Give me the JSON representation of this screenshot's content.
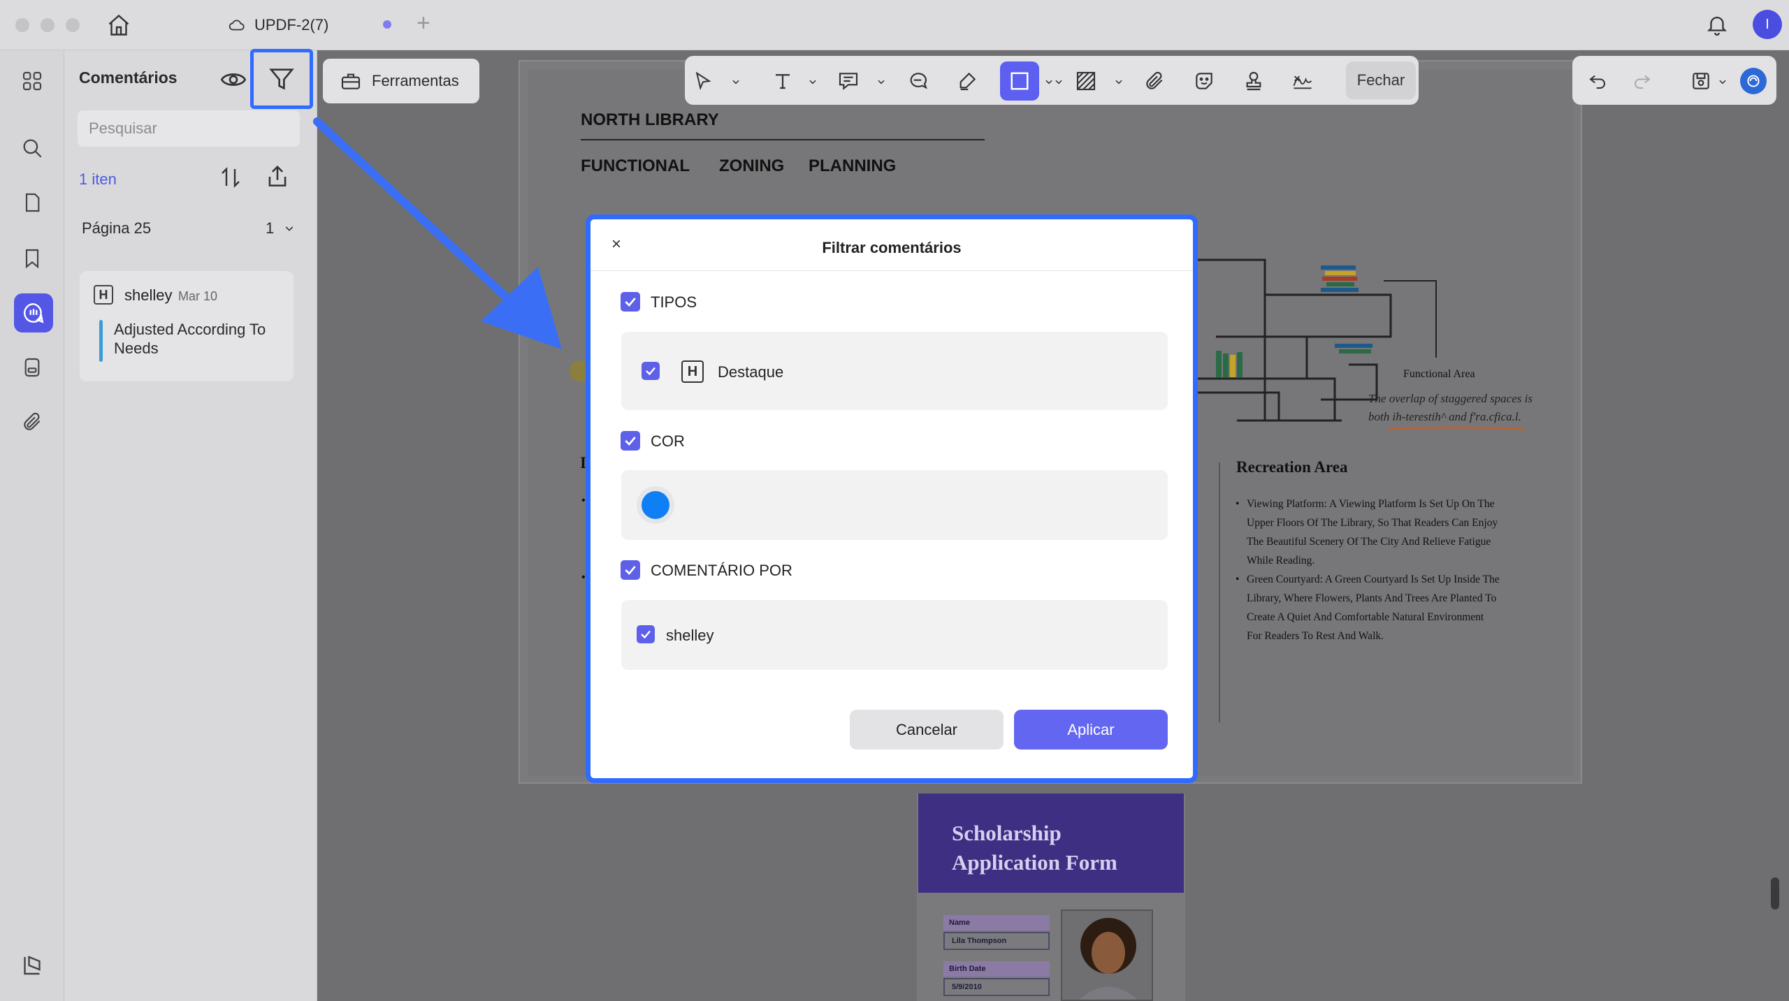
{
  "app": {
    "tab_title": "UPDF-2(7)",
    "avatar_initial": "I",
    "colors": {
      "accent": "#5e60e8",
      "highlight_blue": "#2f6bff",
      "color_filter": "#0f7ff5"
    }
  },
  "sidebar": {
    "icons": [
      "apps-icon",
      "search-icon",
      "page-icon",
      "bookmark-icon",
      "comments-icon",
      "form-icon",
      "attachment-icon"
    ],
    "bottom_icon": "layers-icon"
  },
  "comments_panel": {
    "title": "Comentários",
    "search_placeholder": "Pesquisar",
    "item_count": "1 iten",
    "page_label": "Página 25",
    "page_count": "1",
    "comment": {
      "type_letter": "H",
      "user": "shelley",
      "date": "Mar 10",
      "text": "Adjusted According To Needs"
    }
  },
  "toolbar": {
    "tools_label": "Ferramentas",
    "close_label": "Fechar"
  },
  "document": {
    "title": "NORTH LIBRARY",
    "subtitle_1": "FUNCTIONAL",
    "subtitle_2": "ZONING",
    "subtitle_3": "PLANNING",
    "functional_area": "Functional Area",
    "overlap_note": "The overlap of staggered spaces is both ih-terestih^ and f'ra.cfica.l.",
    "side_letter": "I",
    "recreation": {
      "title": "Recreation Area",
      "items": [
        "Viewing Platform: A Viewing Platform Is Set Up On The Upper Floors Of The Library, So That Readers Can Enjoy The Beautiful Scenery Of The City And Relieve Fatigue While Reading.",
        "Green Courtyard: A Green Courtyard Is Set Up Inside The Library, Where Flowers, Plants And Trees Are Planted To Create A Quiet And Comfortable Natural Environment For Readers To Rest And Walk."
      ]
    },
    "form": {
      "title": "Scholarship Application Form",
      "name_label": "Name",
      "name_value": "Lila Thompson",
      "birth_label": "Birth Date",
      "birth_value": "5/9/2010"
    }
  },
  "modal": {
    "title": "Filtrar comentários",
    "close_glyph": "×",
    "types_label": "TIPOS",
    "type_item": "Destaque",
    "type_item_letter": "H",
    "color_label": "COR",
    "author_label": "COMENTÁRIO POR",
    "author_item": "shelley",
    "cancel_label": "Cancelar",
    "apply_label": "Aplicar"
  }
}
